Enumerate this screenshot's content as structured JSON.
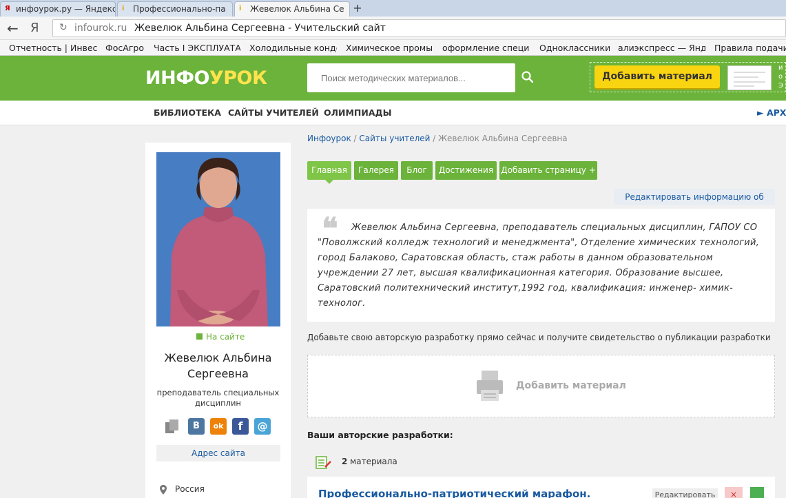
{
  "browser": {
    "tabs": [
      {
        "label": "инфоурок.ру — Яндекс",
        "favicon": "Я"
      },
      {
        "label": "Профессионально-па",
        "favicon": "i"
      },
      {
        "label": "Жевелюк Альбина Се",
        "favicon": "i"
      }
    ],
    "new_tab": "+",
    "back": "←",
    "yandex": "Я",
    "url_host": "infourok.ru",
    "page_title": "Жевелюк Альбина Сергеевна - Учительский сайт",
    "bookmarks": [
      "Отчетность | Инвест",
      "ФосАгро",
      "Часть I ЭКСПЛУАТА",
      "Холодильные конде",
      "Химическое промы",
      "оформление специ",
      "Одноклассники",
      "алиэкспресс — Янд",
      "Правила подачи"
    ]
  },
  "header": {
    "logo_a": "ИНФО",
    "logo_b": "УРОК",
    "search_placeholder": "Поиск методических материалов...",
    "add_button": "Добавить материал",
    "side_text": "и о Э"
  },
  "nav": {
    "items": [
      "БИБЛИОТЕКА",
      "САЙТЫ УЧИТЕЛЕЙ",
      "ОЛИМПИАДЫ"
    ],
    "archive": "► АРХ"
  },
  "profile": {
    "status": "На сайте",
    "name": "Жевелюк Альбина Сергеевна",
    "role": "преподаватель специальных дисциплин",
    "site_address": "Адрес сайта",
    "country": "Россия",
    "social": [
      "B",
      "ok",
      "f",
      "@"
    ]
  },
  "breadcrumb": {
    "home": "Инфоурок",
    "sep1": " / ",
    "sites": "Сайты учителей",
    "sep2": " / ",
    "current": "Жевелюк Альбина Сергеевна"
  },
  "tabs": [
    "Главная",
    "Галерея",
    "Блог",
    "Достижения",
    "Добавить страницу +"
  ],
  "edit_author": "Редактировать информацию об авторе",
  "bio": "Жевелюк Альбина Сергеевна, преподаватель специальных дисциплин, ГАПОУ СО \"Поволжский колледж технологий и менеджмента\", Отделение химических технологий, город Балаково, Саратовская область, стаж работы в данном образовательном учреждении 27 лет, высшая квалификационная категория. Образование высшее, Саратовский политехнический институт,1992 год, квалификация: инженер- химик- технолог.",
  "quote_mark": "❝",
  "invite": "Добавьте свою авторскую разработку прямо сейчас и получите свидетельство о публикации разработки",
  "add_material": "Добавить материал",
  "your_works": "Ваши авторские разработки:",
  "materials_count": "2",
  "materials_word": " материала",
  "item": {
    "title": "Профессионально-патриотический марафон.",
    "edit": "Редактировать",
    "delete": "×"
  },
  "colors": {
    "brand_green": "#6bb33a",
    "accent_yellow": "#f9d410",
    "link_blue": "#1a5aa0"
  }
}
